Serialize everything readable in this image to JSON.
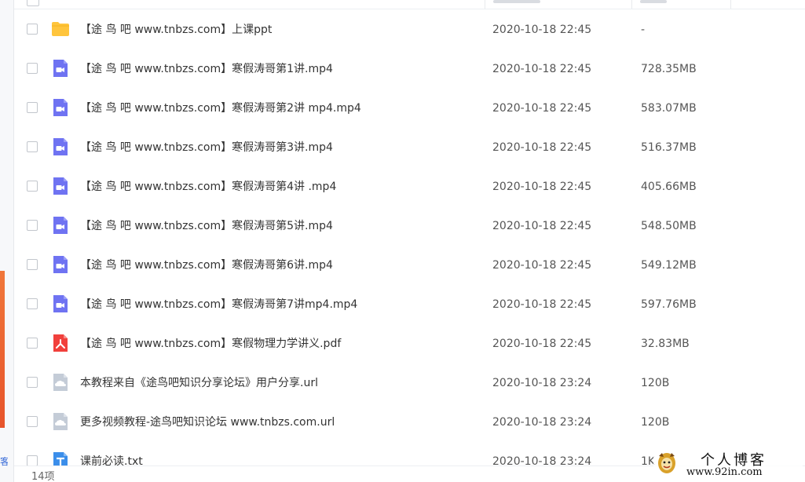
{
  "colors": {
    "folder": "#ffc53d",
    "video": "#6f73f2",
    "pdf": "#f1403c",
    "url": "#c4ccd7",
    "txt": "#3b8eea"
  },
  "files": [
    {
      "icon": "folder",
      "name": "【途 鸟 吧 www.tnbzs.com】上课ppt",
      "date": "2020-10-18 22:45",
      "size": "-"
    },
    {
      "icon": "video",
      "name": "【途 鸟 吧 www.tnbzs.com】寒假涛哥第1讲.mp4",
      "date": "2020-10-18 22:45",
      "size": "728.35MB"
    },
    {
      "icon": "video",
      "name": "【途 鸟 吧 www.tnbzs.com】寒假涛哥第2讲 mp4.mp4",
      "date": "2020-10-18 22:45",
      "size": "583.07MB"
    },
    {
      "icon": "video",
      "name": "【途 鸟 吧 www.tnbzs.com】寒假涛哥第3讲.mp4",
      "date": "2020-10-18 22:45",
      "size": "516.37MB"
    },
    {
      "icon": "video",
      "name": "【途 鸟 吧 www.tnbzs.com】寒假涛哥第4讲 .mp4",
      "date": "2020-10-18 22:45",
      "size": "405.66MB"
    },
    {
      "icon": "video",
      "name": "【途 鸟 吧 www.tnbzs.com】寒假涛哥第5讲.mp4",
      "date": "2020-10-18 22:45",
      "size": "548.50MB"
    },
    {
      "icon": "video",
      "name": "【途 鸟 吧 www.tnbzs.com】寒假涛哥第6讲.mp4",
      "date": "2020-10-18 22:45",
      "size": "549.12MB"
    },
    {
      "icon": "video",
      "name": "【途 鸟 吧 www.tnbzs.com】寒假涛哥第7讲mp4.mp4",
      "date": "2020-10-18 22:45",
      "size": "597.76MB"
    },
    {
      "icon": "pdf",
      "name": "【途 鸟 吧 www.tnbzs.com】寒假物理力学讲义.pdf",
      "date": "2020-10-18 22:45",
      "size": "32.83MB"
    },
    {
      "icon": "url",
      "name": "本教程来自《途鸟吧知识分享论坛》用户分享.url",
      "date": "2020-10-18 23:24",
      "size": "120B"
    },
    {
      "icon": "url",
      "name": "更多视频教程-途鸟吧知识论坛 www.tnbzs.com.url",
      "date": "2020-10-18 23:24",
      "size": "120B"
    },
    {
      "icon": "txt",
      "name": "课前必读.txt",
      "date": "2020-10-18 23:24",
      "size": "1K"
    }
  ],
  "footer": {
    "item_count": "14项"
  },
  "watermark": {
    "title": "个人博客",
    "url": "www.92in.com"
  },
  "left_strip": {
    "glyph": "客"
  }
}
